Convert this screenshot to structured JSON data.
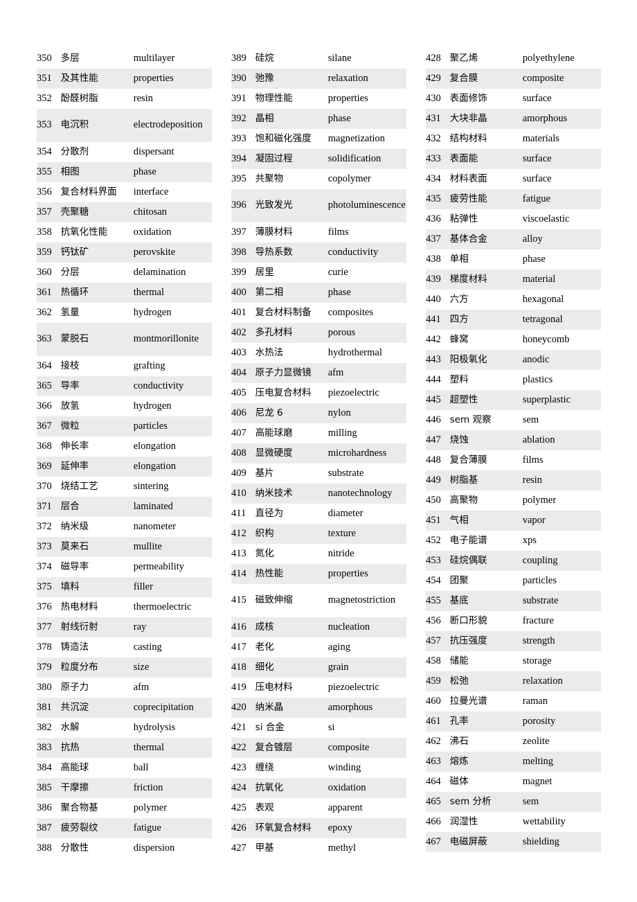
{
  "document": {
    "type": "glossary-table",
    "description": "Three-column numbered Chinese-English term glossary, entries 350-467",
    "row_shading_color": "#ebebeb",
    "page_background": "#ffffff",
    "text_color": "#000000"
  },
  "columns": [
    {
      "name": "column-left",
      "rows": [
        {
          "num": "350",
          "zh": "多层",
          "en": "multilayer",
          "tall": false
        },
        {
          "num": "351",
          "zh": "及其性能",
          "en": "properties",
          "tall": false
        },
        {
          "num": "352",
          "zh": "酚醛树脂",
          "en": "resin",
          "tall": false
        },
        {
          "num": "353",
          "zh": "电沉积",
          "en": "electrodeposition",
          "tall": true
        },
        {
          "num": "354",
          "zh": "分散剂",
          "en": "dispersant",
          "tall": false
        },
        {
          "num": "355",
          "zh": "相图",
          "en": "phase",
          "tall": false
        },
        {
          "num": "356",
          "zh": "复合材料界面",
          "en": "interface",
          "tall": false
        },
        {
          "num": "357",
          "zh": "壳聚糖",
          "en": "chitosan",
          "tall": false
        },
        {
          "num": "358",
          "zh": "抗氧化性能",
          "en": "oxidation",
          "tall": false
        },
        {
          "num": "359",
          "zh": "钙钛矿",
          "en": "perovskite",
          "tall": false
        },
        {
          "num": "360",
          "zh": "分层",
          "en": "delamination",
          "tall": false
        },
        {
          "num": "361",
          "zh": "热循环",
          "en": "thermal",
          "tall": false
        },
        {
          "num": "362",
          "zh": "氢量",
          "en": "hydrogen",
          "tall": false
        },
        {
          "num": "363",
          "zh": "蒙脱石",
          "en": "montmorillonite",
          "tall": true
        },
        {
          "num": "364",
          "zh": "接枝",
          "en": "grafting",
          "tall": false
        },
        {
          "num": "365",
          "zh": "导率",
          "en": "conductivity",
          "tall": false
        },
        {
          "num": "366",
          "zh": "放氢",
          "en": "hydrogen",
          "tall": false
        },
        {
          "num": "367",
          "zh": "微粒",
          "en": "particles",
          "tall": false
        },
        {
          "num": "368",
          "zh": "伸长率",
          "en": "elongation",
          "tall": false
        },
        {
          "num": "369",
          "zh": "延伸率",
          "en": "elongation",
          "tall": false
        },
        {
          "num": "370",
          "zh": "烧结工艺",
          "en": "sintering",
          "tall": false
        },
        {
          "num": "371",
          "zh": "层合",
          "en": "laminated",
          "tall": false
        },
        {
          "num": "372",
          "zh": "纳米级",
          "en": "nanometer",
          "tall": false
        },
        {
          "num": "373",
          "zh": "莫来石",
          "en": "mullite",
          "tall": false
        },
        {
          "num": "374",
          "zh": "磁导率",
          "en": "permeability",
          "tall": false
        },
        {
          "num": "375",
          "zh": "填料",
          "en": "filler",
          "tall": false
        },
        {
          "num": "376",
          "zh": "热电材料",
          "en": "thermoelectric",
          "tall": false
        },
        {
          "num": "377",
          "zh": "射线衍射",
          "en": "ray",
          "tall": false
        },
        {
          "num": "378",
          "zh": "铸造法",
          "en": "casting",
          "tall": false
        },
        {
          "num": "379",
          "zh": "粒度分布",
          "en": "size",
          "tall": false
        },
        {
          "num": "380",
          "zh": "原子力",
          "en": "afm",
          "tall": false
        },
        {
          "num": "381",
          "zh": "共沉淀",
          "en": "coprecipitation",
          "tall": false
        },
        {
          "num": "382",
          "zh": "水解",
          "en": "hydrolysis",
          "tall": false
        },
        {
          "num": "383",
          "zh": "抗热",
          "en": "thermal",
          "tall": false
        },
        {
          "num": "384",
          "zh": "高能球",
          "en": "ball",
          "tall": false
        },
        {
          "num": "385",
          "zh": "干摩擦",
          "en": "friction",
          "tall": false
        },
        {
          "num": "386",
          "zh": "聚合物基",
          "en": "polymer",
          "tall": false
        },
        {
          "num": "387",
          "zh": "疲劳裂纹",
          "en": "fatigue",
          "tall": false
        },
        {
          "num": "388",
          "zh": "分散性",
          "en": "dispersion",
          "tall": false
        }
      ]
    },
    {
      "name": "column-middle",
      "rows": [
        {
          "num": "389",
          "zh": "硅烷",
          "en": "silane",
          "tall": false
        },
        {
          "num": "390",
          "zh": "弛豫",
          "en": "relaxation",
          "tall": false
        },
        {
          "num": "391",
          "zh": "物理性能",
          "en": "properties",
          "tall": false
        },
        {
          "num": "392",
          "zh": "晶相",
          "en": "phase",
          "tall": false
        },
        {
          "num": "393",
          "zh": "饱和磁化强度",
          "en": "magnetization",
          "tall": false
        },
        {
          "num": "394",
          "zh": "凝固过程",
          "en": "solidification",
          "tall": false
        },
        {
          "num": "395",
          "zh": "共聚物",
          "en": "copolymer",
          "tall": false
        },
        {
          "num": "396",
          "zh": "光致发光",
          "en": "photoluminescence",
          "tall": true
        },
        {
          "num": "397",
          "zh": "薄膜材料",
          "en": "films",
          "tall": false
        },
        {
          "num": "398",
          "zh": "导热系数",
          "en": "conductivity",
          "tall": false
        },
        {
          "num": "399",
          "zh": "居里",
          "en": "curie",
          "tall": false
        },
        {
          "num": "400",
          "zh": "第二相",
          "en": "phase",
          "tall": false
        },
        {
          "num": "401",
          "zh": "复合材料制备",
          "en": "composites",
          "tall": false
        },
        {
          "num": "402",
          "zh": "多孔材料",
          "en": "porous",
          "tall": false
        },
        {
          "num": "403",
          "zh": "水热法",
          "en": "hydrothermal",
          "tall": false
        },
        {
          "num": "404",
          "zh": "原子力显微镜",
          "en": "afm",
          "tall": false
        },
        {
          "num": "405",
          "zh": "压电复合材料",
          "en": "piezoelectric",
          "tall": false
        },
        {
          "num": "406",
          "zh": "尼龙 6",
          "en": "nylon",
          "tall": false
        },
        {
          "num": "407",
          "zh": "高能球磨",
          "en": "milling",
          "tall": false
        },
        {
          "num": "408",
          "zh": "显微硬度",
          "en": "microhardness",
          "tall": false
        },
        {
          "num": "409",
          "zh": "基片",
          "en": "substrate",
          "tall": false
        },
        {
          "num": "410",
          "zh": "纳米技术",
          "en": "nanotechnology",
          "tall": false
        },
        {
          "num": "411",
          "zh": "直径为",
          "en": "diameter",
          "tall": false
        },
        {
          "num": "412",
          "zh": "织构",
          "en": "texture",
          "tall": false
        },
        {
          "num": "413",
          "zh": "氮化",
          "en": "nitride",
          "tall": false
        },
        {
          "num": "414",
          "zh": "热性能",
          "en": "properties",
          "tall": false
        },
        {
          "num": "415",
          "zh": "磁致伸缩",
          "en": "magnetostriction",
          "tall": true
        },
        {
          "num": "416",
          "zh": "成核",
          "en": "nucleation",
          "tall": false
        },
        {
          "num": "417",
          "zh": "老化",
          "en": "aging",
          "tall": false
        },
        {
          "num": "418",
          "zh": "细化",
          "en": "grain",
          "tall": false
        },
        {
          "num": "419",
          "zh": "压电材料",
          "en": "piezoelectric",
          "tall": false
        },
        {
          "num": "420",
          "zh": "纳米晶",
          "en": "amorphous",
          "tall": false
        },
        {
          "num": "421",
          "zh": "si 合金",
          "en": "si",
          "tall": false
        },
        {
          "num": "422",
          "zh": "复合镀层",
          "en": "composite",
          "tall": false
        },
        {
          "num": "423",
          "zh": "缠绕",
          "en": "winding",
          "tall": false
        },
        {
          "num": "424",
          "zh": "抗氧化",
          "en": "oxidation",
          "tall": false
        },
        {
          "num": "425",
          "zh": "表观",
          "en": "apparent",
          "tall": false
        },
        {
          "num": "426",
          "zh": "环氧复合材料",
          "en": "epoxy",
          "tall": false
        },
        {
          "num": "427",
          "zh": "甲基",
          "en": "methyl",
          "tall": false
        }
      ]
    },
    {
      "name": "column-right",
      "rows": [
        {
          "num": "428",
          "zh": "聚乙烯",
          "en": "polyethylene",
          "tall": false
        },
        {
          "num": "429",
          "zh": "复合膜",
          "en": "composite",
          "tall": false
        },
        {
          "num": "430",
          "zh": "表面修饰",
          "en": "surface",
          "tall": false
        },
        {
          "num": "431",
          "zh": "大块非晶",
          "en": "amorphous",
          "tall": false
        },
        {
          "num": "432",
          "zh": "结构材料",
          "en": "materials",
          "tall": false
        },
        {
          "num": "433",
          "zh": "表面能",
          "en": "surface",
          "tall": false
        },
        {
          "num": "434",
          "zh": "材料表面",
          "en": "surface",
          "tall": false
        },
        {
          "num": "435",
          "zh": "疲劳性能",
          "en": "fatigue",
          "tall": false
        },
        {
          "num": "436",
          "zh": "粘弹性",
          "en": "viscoelastic",
          "tall": false
        },
        {
          "num": "437",
          "zh": "基体合金",
          "en": "alloy",
          "tall": false
        },
        {
          "num": "438",
          "zh": "单相",
          "en": "phase",
          "tall": false
        },
        {
          "num": "439",
          "zh": "梯度材料",
          "en": "material",
          "tall": false
        },
        {
          "num": "440",
          "zh": "六方",
          "en": "hexagonal",
          "tall": false
        },
        {
          "num": "441",
          "zh": "四方",
          "en": "tetragonal",
          "tall": false
        },
        {
          "num": "442",
          "zh": "蜂窝",
          "en": "honeycomb",
          "tall": false
        },
        {
          "num": "443",
          "zh": "阳极氧化",
          "en": "anodic",
          "tall": false
        },
        {
          "num": "444",
          "zh": "塑料",
          "en": "plastics",
          "tall": false
        },
        {
          "num": "445",
          "zh": "超塑性",
          "en": "superplastic",
          "tall": false
        },
        {
          "num": "446",
          "zh": "sem 观察",
          "en": "sem",
          "tall": false
        },
        {
          "num": "447",
          "zh": "烧蚀",
          "en": "ablation",
          "tall": false
        },
        {
          "num": "448",
          "zh": "复合薄膜",
          "en": "films",
          "tall": false
        },
        {
          "num": "449",
          "zh": "树脂基",
          "en": "resin",
          "tall": false
        },
        {
          "num": "450",
          "zh": "高聚物",
          "en": "polymer",
          "tall": false
        },
        {
          "num": "451",
          "zh": "气相",
          "en": "vapor",
          "tall": false
        },
        {
          "num": "452",
          "zh": "电子能谱",
          "en": "xps",
          "tall": false
        },
        {
          "num": "453",
          "zh": "硅烷偶联",
          "en": "coupling",
          "tall": false
        },
        {
          "num": "454",
          "zh": "团聚",
          "en": "particles",
          "tall": false
        },
        {
          "num": "455",
          "zh": "基底",
          "en": "substrate",
          "tall": false
        },
        {
          "num": "456",
          "zh": "断口形貌",
          "en": "fracture",
          "tall": false
        },
        {
          "num": "457",
          "zh": "抗压强度",
          "en": "strength",
          "tall": false
        },
        {
          "num": "458",
          "zh": "储能",
          "en": "storage",
          "tall": false
        },
        {
          "num": "459",
          "zh": "松弛",
          "en": "relaxation",
          "tall": false
        },
        {
          "num": "460",
          "zh": "拉曼光谱",
          "en": "raman",
          "tall": false
        },
        {
          "num": "461",
          "zh": "孔率",
          "en": "porosity",
          "tall": false
        },
        {
          "num": "462",
          "zh": "沸石",
          "en": "zeolite",
          "tall": false
        },
        {
          "num": "463",
          "zh": "熔炼",
          "en": "melting",
          "tall": false
        },
        {
          "num": "464",
          "zh": "磁体",
          "en": "magnet",
          "tall": false
        },
        {
          "num": "465",
          "zh": "sem 分析",
          "en": "sem",
          "tall": false
        },
        {
          "num": "466",
          "zh": "润湿性",
          "en": "wettability",
          "tall": false
        },
        {
          "num": "467",
          "zh": "电磁屏蔽",
          "en": "shielding",
          "tall": false
        }
      ]
    }
  ]
}
